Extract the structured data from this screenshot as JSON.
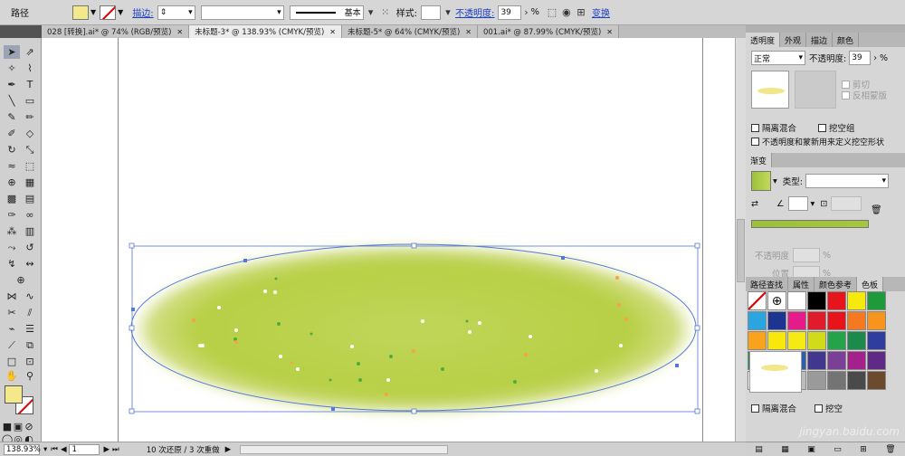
{
  "control_bar": {
    "object_label": "路径",
    "stroke_link": "描边:",
    "stroke_profile": "基本",
    "style_label": "样式:",
    "opacity_link": "不透明度:",
    "opacity_value": "39",
    "opacity_unit": "%",
    "transform_link": "变换"
  },
  "tabs": [
    {
      "label": "028 [转换].ai* @ 74% (RGB/预览)",
      "active": false
    },
    {
      "label": "未标题-3* @ 138.93% (CMYK/预览)",
      "active": true
    },
    {
      "label": "未标题-5* @ 64% (CMYK/预览)",
      "active": false
    },
    {
      "label": "001.ai* @ 87.99% (CMYK/预览)",
      "active": false
    }
  ],
  "transparency_panel": {
    "tabs": [
      "透明度",
      "外观",
      "描边",
      "颜色"
    ],
    "blend_mode": "正常",
    "opacity_label": "不透明度:",
    "opacity_value": "39",
    "clip_label": "剪切",
    "invert_mask_label": "反相蒙版",
    "isolate_blend_label": "隔离混合",
    "knockout_label": "挖空组",
    "define_knockout_label": "不透明度和蒙新用来定义挖空形状"
  },
  "gradient_panel": {
    "tab": "渐变",
    "type_label": "类型:",
    "opacity_label": "不透明度",
    "location_label": "位置",
    "percent": "%"
  },
  "swatches_panel": {
    "tabs": [
      "路径查找",
      "属性",
      "颜色参考",
      "色板"
    ],
    "colors": [
      "#ffffff",
      "#ffffff",
      "#ffffff",
      "#000000",
      "#e8141c",
      "#f5e90e",
      "#1e9a3a",
      "#2aa5e0",
      "#1d3590",
      "#e51b89",
      "#e01b2b",
      "#e8141c",
      "#f47920",
      "#f7941d",
      "#f9a21d",
      "#f7e70b",
      "#f5ea14",
      "#d2db1a",
      "#25a34a",
      "#1b8a4b",
      "#2f3e9e",
      "#1b8a4b",
      "#25a6d1",
      "#2e5fa8",
      "#41378e",
      "#7b3f98",
      "#a4218d",
      "#5e2a86",
      "#ffffff",
      "#e6e6e6",
      "#bcbcbc",
      "#9a9a9a",
      "#747474",
      "#4a4a4a",
      "#6b4a2e",
      "#ffffff",
      "#ffffff",
      "#ffffff",
      "#ffffff",
      "#c8b89a",
      "#a08060",
      "#5a3a22"
    ],
    "isolate_blend_label": "隔离混合",
    "knockout_label": "挖空"
  },
  "status_bar": {
    "zoom": "138.93%",
    "page": "1",
    "history": "10 次还原 / 3 次重做"
  },
  "canvas": {
    "fill_color": "#c5d962",
    "stroke_color": "#5578d8"
  },
  "watermark": "jingyan.baidu.com"
}
